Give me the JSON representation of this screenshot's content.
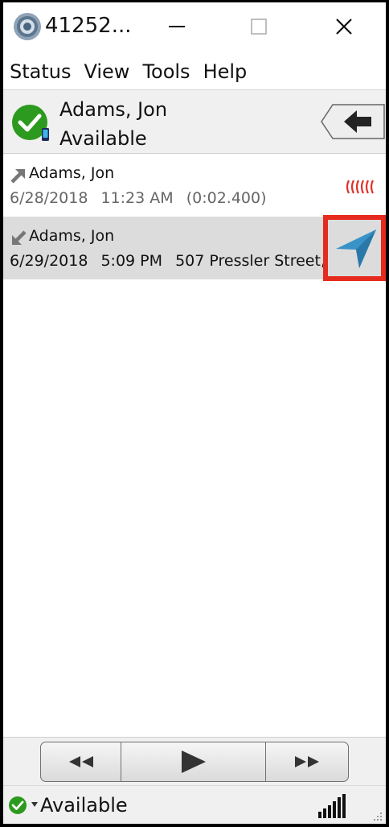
{
  "window": {
    "title": "41252..."
  },
  "menu": {
    "items": [
      "Status",
      "View",
      "Tools",
      "Help"
    ]
  },
  "header": {
    "contact_name": "Adams, Jon",
    "contact_status": "Available"
  },
  "calls": [
    {
      "direction": "outgoing",
      "name": "Adams, Jon",
      "date": "6/28/2018",
      "time": "11:23 AM",
      "extra": "(0:02.400)"
    },
    {
      "direction": "incoming",
      "name": "Adams, Jon",
      "date": "6/29/2018",
      "time": "5:09 PM",
      "extra": "507 Pressler Street, ..."
    }
  ],
  "statusbar": {
    "status_text": "Available"
  },
  "colors": {
    "available_green": "#2c9a1e",
    "signal_red": "#e0332b",
    "location_blue": "#3a93c8",
    "highlight_red": "#e52b1d",
    "selected_row": "#dcdcdc"
  }
}
